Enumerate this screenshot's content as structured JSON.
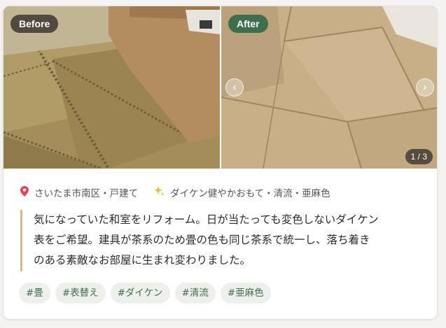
{
  "photos": {
    "before_label": "Before",
    "after_label": "After",
    "prev_glyph": "‹",
    "next_glyph": "›",
    "counter": "1 / 3"
  },
  "meta": {
    "location_icon": "pin-icon",
    "location": "さいたま市南区・戸建て",
    "product_icon": "sparkles-icon",
    "product": "ダイケン健やかおもて・清流・亜麻色"
  },
  "description": {
    "lines": [
      "気になっていた和室をリフォーム。日が当たっても変色しないダイケン",
      "表をご希望。建具が茶系のため畳の色も同じ茶系で統一し、落ち着き",
      "のある素敵なお部屋に生まれ変わりました。"
    ]
  },
  "tags": [
    "#畳",
    "#表替え",
    "#ダイケン",
    "#清流",
    "#亜麻色"
  ],
  "colors": {
    "after_badge": "#3f6e4f",
    "tag_text": "#3f6e4f",
    "quote_bar": "#d9b88a"
  }
}
